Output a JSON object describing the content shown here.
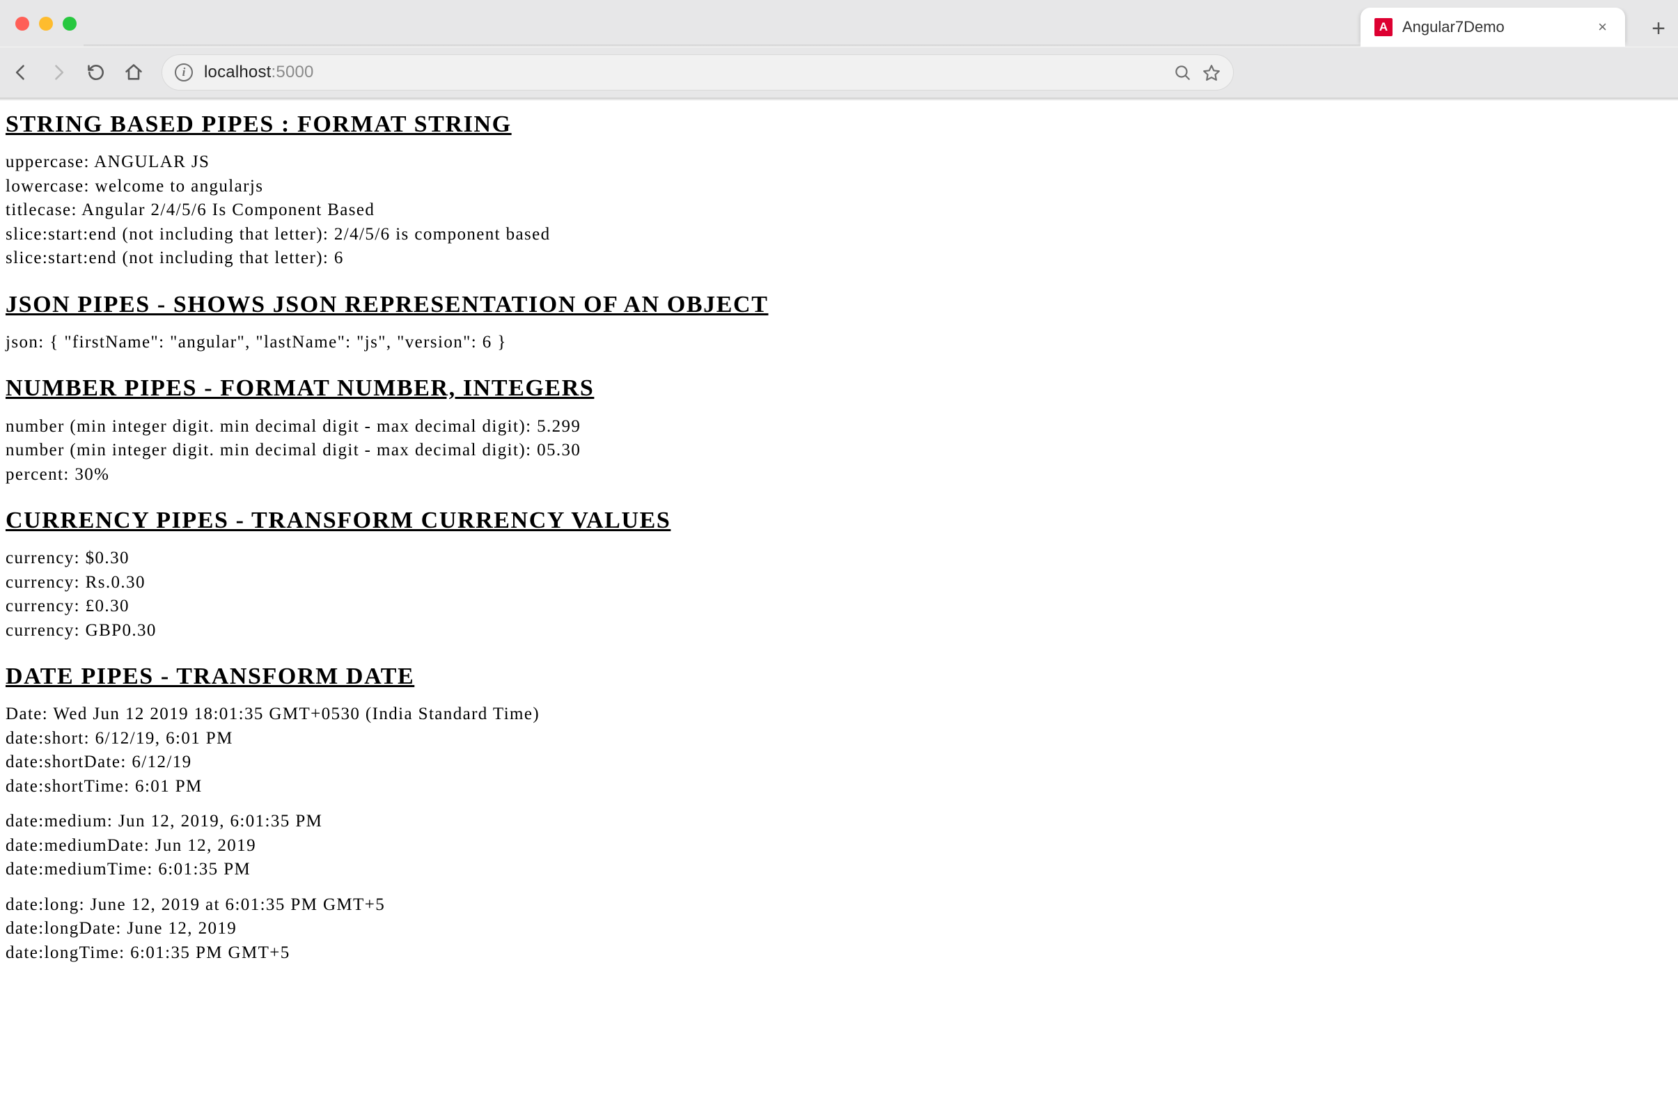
{
  "browser": {
    "tab_title": "Angular7Demo",
    "url_host": "localhost",
    "url_port": ":5000"
  },
  "sections": {
    "string": {
      "heading": "STRING BASED PIPES : FORMAT STRING",
      "uppercase": "uppercase: ANGULAR JS",
      "lowercase": "lowercase: welcome to angularjs",
      "titlecase": "titlecase: Angular 2/4/5/6 Is Component Based",
      "slice1": "slice:start:end (not including that letter): 2/4/5/6 is component based",
      "slice2": "slice:start:end (not including that letter): 6"
    },
    "json": {
      "heading": "JSON PIPES - SHOWS JSON REPRESENTATION OF AN OBJECT",
      "line": "json: { \"firstName\": \"angular\", \"lastName\": \"js\", \"version\": 6 }"
    },
    "number": {
      "heading": "NUMBER PIPES - FORMAT NUMBER, INTEGERS",
      "n1": "number (min integer digit. min decimal digit - max decimal digit): 5.299",
      "n2": "number (min integer digit. min decimal digit - max decimal digit): 05.30",
      "percent": "percent: 30%"
    },
    "currency": {
      "heading": "CURRENCY PIPES - TRANSFORM CURRENCY VALUES",
      "c1": "currency: $0.30",
      "c2": "currency: Rs.0.30",
      "c3": "currency: £0.30",
      "c4": "currency: GBP0.30"
    },
    "date": {
      "heading": "DATE PIPES - TRANSFORM DATE",
      "d0": "Date: Wed Jun 12 2019 18:01:35 GMT+0530 (India Standard Time)",
      "short": "date:short: 6/12/19, 6:01 PM",
      "shortDate": "date:shortDate: 6/12/19",
      "shortTime": "date:shortTime: 6:01 PM",
      "medium": "date:medium: Jun 12, 2019, 6:01:35 PM",
      "mediumDate": "date:mediumDate: Jun 12, 2019",
      "mediumTime": "date:mediumTime: 6:01:35 PM",
      "long": "date:long: June 12, 2019 at 6:01:35 PM GMT+5",
      "longDate": "date:longDate: June 12, 2019",
      "longTime": "date:longTime: 6:01:35 PM GMT+5"
    }
  }
}
